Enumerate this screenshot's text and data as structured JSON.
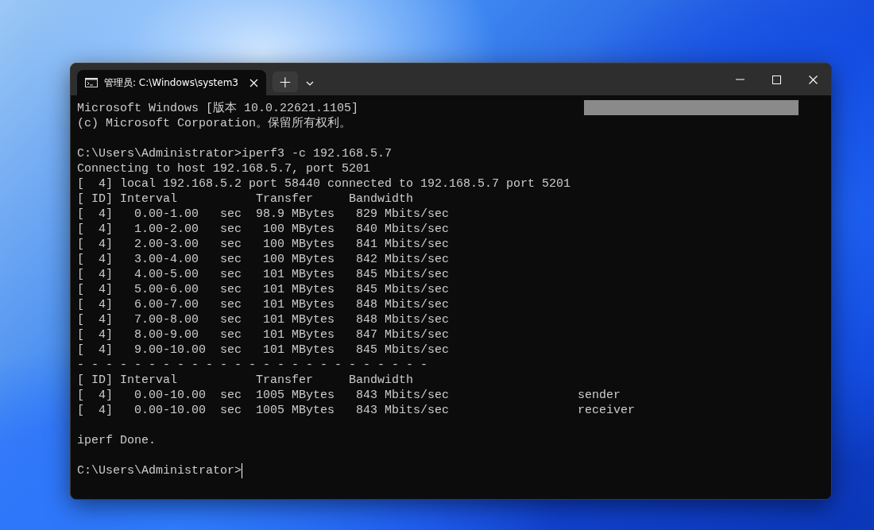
{
  "tab": {
    "title": "管理员: C:\\Windows\\system3",
    "selected": true
  },
  "new_tab": "+",
  "terminal": {
    "blocks": [
      [
        "Microsoft Windows [版本 10.0.22621.1105]",
        "(c) Microsoft Corporation。保留所有权利。"
      ],
      [
        "C:\\Users\\Administrator>iperf3 -c 192.168.5.7",
        "Connecting to host 192.168.5.7, port 5201",
        "[  4] local 192.168.5.2 port 58440 connected to 192.168.5.7 port 5201",
        "[ ID] Interval           Transfer     Bandwidth",
        "[  4]   0.00-1.00   sec  98.9 MBytes   829 Mbits/sec",
        "[  4]   1.00-2.00   sec   100 MBytes   840 Mbits/sec",
        "[  4]   2.00-3.00   sec   100 MBytes   841 Mbits/sec",
        "[  4]   3.00-4.00   sec   100 MBytes   842 Mbits/sec",
        "[  4]   4.00-5.00   sec   101 MBytes   845 Mbits/sec",
        "[  4]   5.00-6.00   sec   101 MBytes   845 Mbits/sec",
        "[  4]   6.00-7.00   sec   101 MBytes   848 Mbits/sec",
        "[  4]   7.00-8.00   sec   101 MBytes   848 Mbits/sec",
        "[  4]   8.00-9.00   sec   101 MBytes   847 Mbits/sec",
        "[  4]   9.00-10.00  sec   101 MBytes   845 Mbits/sec",
        "- - - - - - - - - - - - - - - - - - - - - - - - -",
        "[ ID] Interval           Transfer     Bandwidth",
        "[  4]   0.00-10.00  sec  1005 MBytes   843 Mbits/sec                  sender",
        "[  4]   0.00-10.00  sec  1005 MBytes   843 Mbits/sec                  receiver"
      ],
      [
        "iperf Done."
      ]
    ],
    "prompt": "C:\\Users\\Administrator>"
  }
}
